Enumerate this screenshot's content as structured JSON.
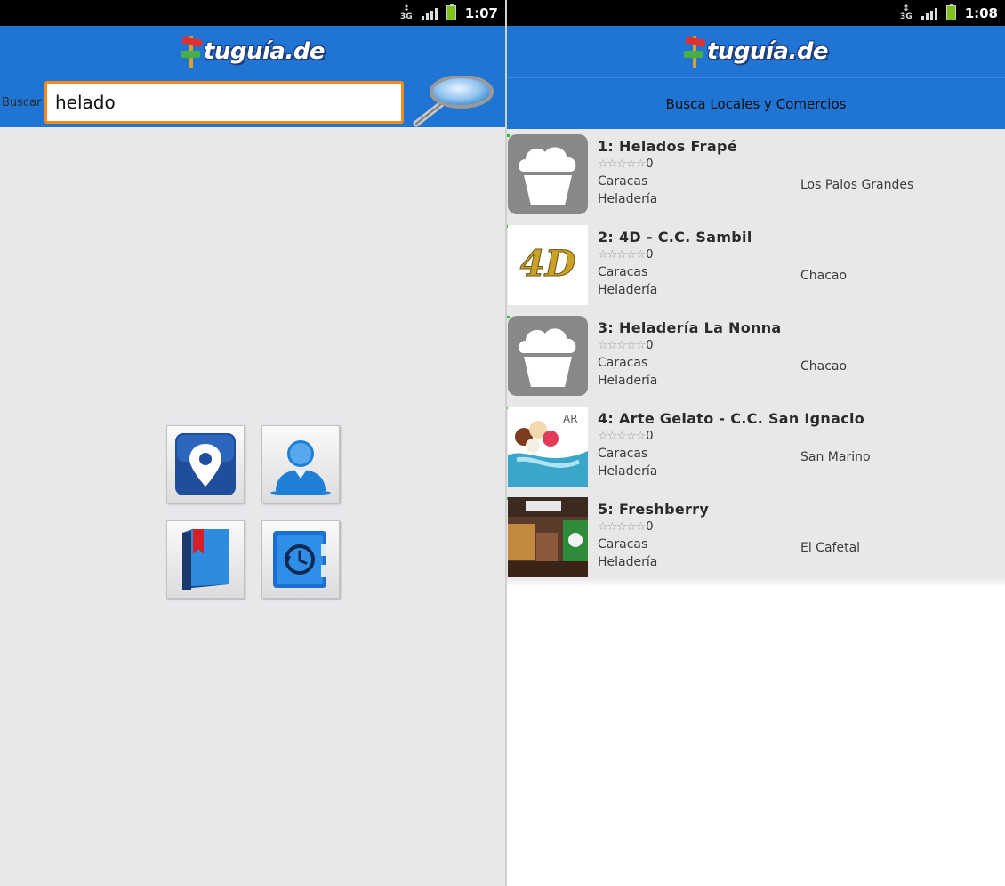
{
  "left": {
    "status": {
      "network": "3G",
      "time": "1:07"
    },
    "header": {
      "logo_text": "tuguía.de"
    },
    "search": {
      "label": "Buscar",
      "value": "helado"
    },
    "menu": [
      {
        "icon": "map-pin-icon"
      },
      {
        "icon": "user-profile-icon"
      },
      {
        "icon": "bookmark-book-icon"
      },
      {
        "icon": "history-clock-icon"
      }
    ]
  },
  "right": {
    "status": {
      "network": "3G",
      "time": "1:08"
    },
    "header": {
      "logo_text": "tuguía.de"
    },
    "subtitle": "Busca Locales y Comercios",
    "results": [
      {
        "title": "1: Helados Frapé",
        "rating": "0",
        "city": "Caracas",
        "area": "Los Palos Grandes",
        "category": "Heladería",
        "thumb": "cupcake-placeholder-icon"
      },
      {
        "title": "2: 4D - C.C. Sambil",
        "rating": "0",
        "city": "Caracas",
        "area": "Chacao",
        "category": "Heladería",
        "thumb": "4d-logo"
      },
      {
        "title": "3: Heladería La Nonna",
        "rating": "0",
        "city": "Caracas",
        "area": "Chacao",
        "category": "Heladería",
        "thumb": "cupcake-placeholder-icon"
      },
      {
        "title": "4: Arte Gelato - C.C. San Ignacio",
        "rating": "0",
        "city": "Caracas",
        "area": "San Marino",
        "category": "Heladería",
        "thumb": "arte-gelato-photo"
      },
      {
        "title": "5: Freshberry",
        "rating": "0",
        "city": "Caracas",
        "area": "El Cafetal",
        "category": "Heladería",
        "thumb": "freshberry-photo"
      }
    ]
  },
  "colors": {
    "header_blue": "#2074d3",
    "search_border": "#f28c1a",
    "screen_bg": "#e9e7ea"
  }
}
